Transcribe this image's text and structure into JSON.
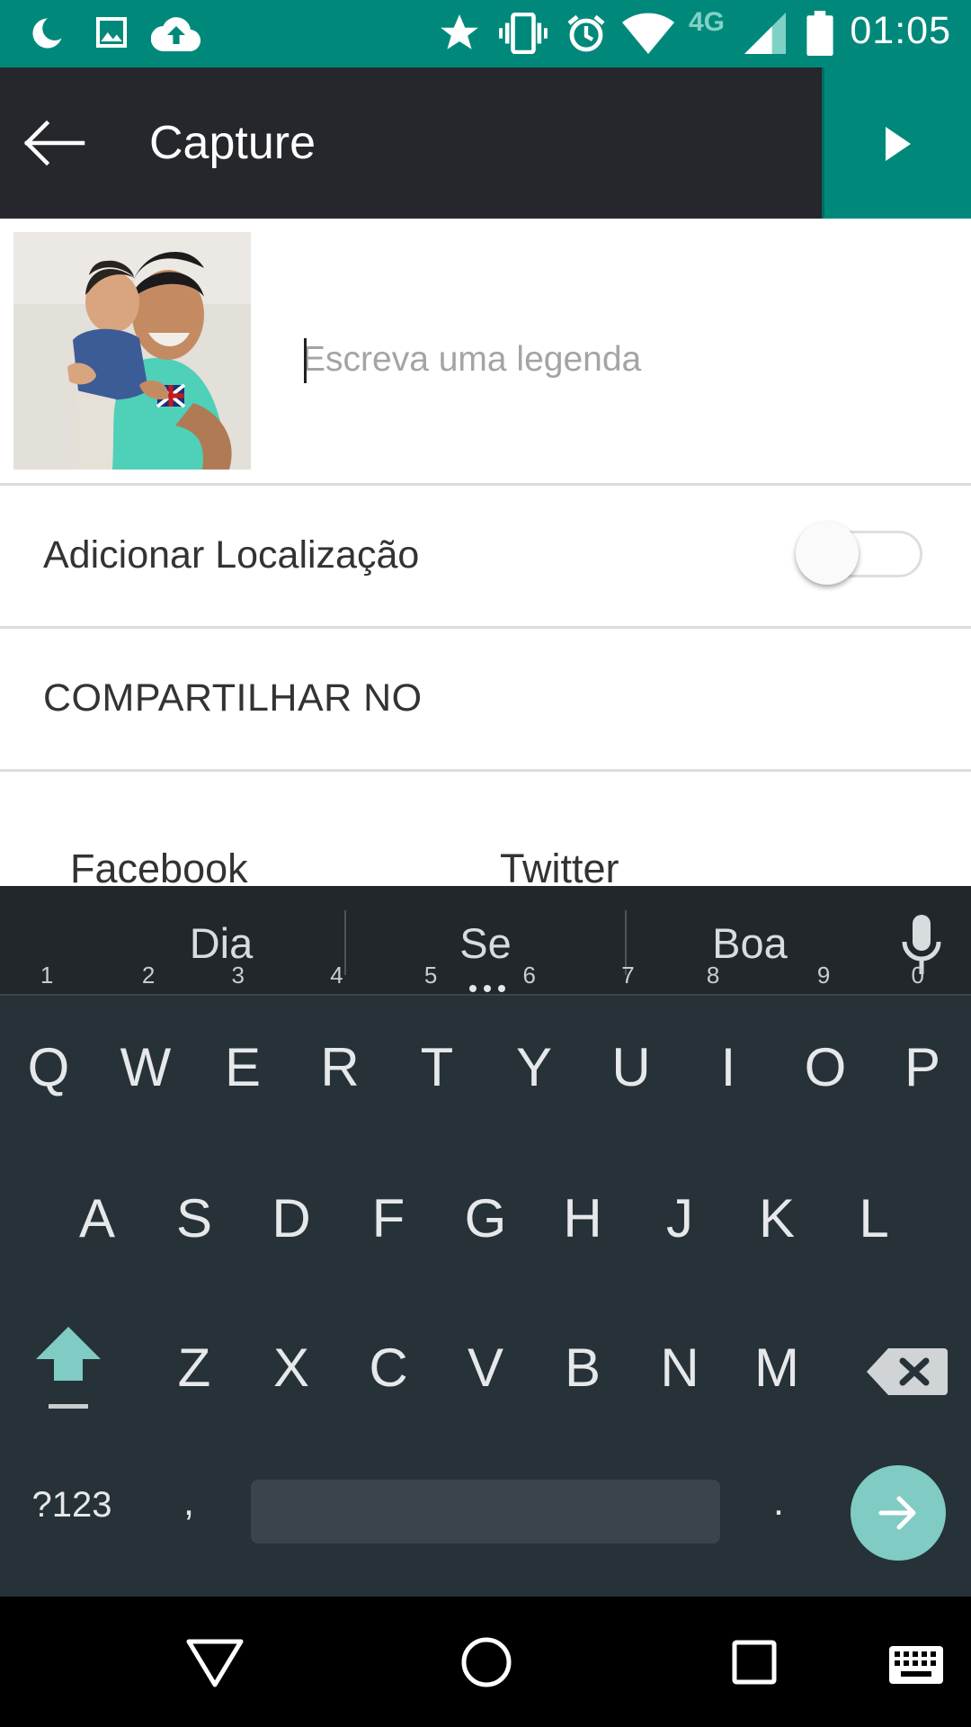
{
  "status_bar": {
    "time": "01:05",
    "network": "4G",
    "icons": [
      "moon-icon",
      "image-icon",
      "cloud-upload-icon",
      "star-icon",
      "vibrate-icon",
      "alarm-icon",
      "wifi-icon",
      "signal-icon",
      "battery-icon"
    ]
  },
  "app_bar": {
    "title": "Capture",
    "back_icon": "arrow-left-icon",
    "next_icon": "play-arrow-icon"
  },
  "caption": {
    "placeholder": "Escreva uma legenda",
    "value": ""
  },
  "location": {
    "label": "Adicionar Localização",
    "enabled": false
  },
  "share": {
    "header": "COMPARTILHAR NO",
    "options": [
      "Facebook",
      "Twitter"
    ]
  },
  "keyboard": {
    "suggestions": [
      "Dia",
      "Se",
      "Boa"
    ],
    "row1": [
      {
        "key": "Q",
        "hint": "1"
      },
      {
        "key": "W",
        "hint": "2"
      },
      {
        "key": "E",
        "hint": "3"
      },
      {
        "key": "R",
        "hint": "4"
      },
      {
        "key": "T",
        "hint": "5"
      },
      {
        "key": "Y",
        "hint": "6"
      },
      {
        "key": "U",
        "hint": "7"
      },
      {
        "key": "I",
        "hint": "8"
      },
      {
        "key": "O",
        "hint": "9"
      },
      {
        "key": "P",
        "hint": "0"
      }
    ],
    "row2": [
      "A",
      "S",
      "D",
      "F",
      "G",
      "H",
      "J",
      "K",
      "L"
    ],
    "row3": [
      "Z",
      "X",
      "C",
      "V",
      "B",
      "N",
      "M"
    ],
    "symbols_label": "?123",
    "comma": ",",
    "period": ".",
    "accent_color": "#80cbc4"
  },
  "colors": {
    "status_bar": "#00897b",
    "app_bar": "#26272d",
    "keyboard_bg": "#263238"
  }
}
